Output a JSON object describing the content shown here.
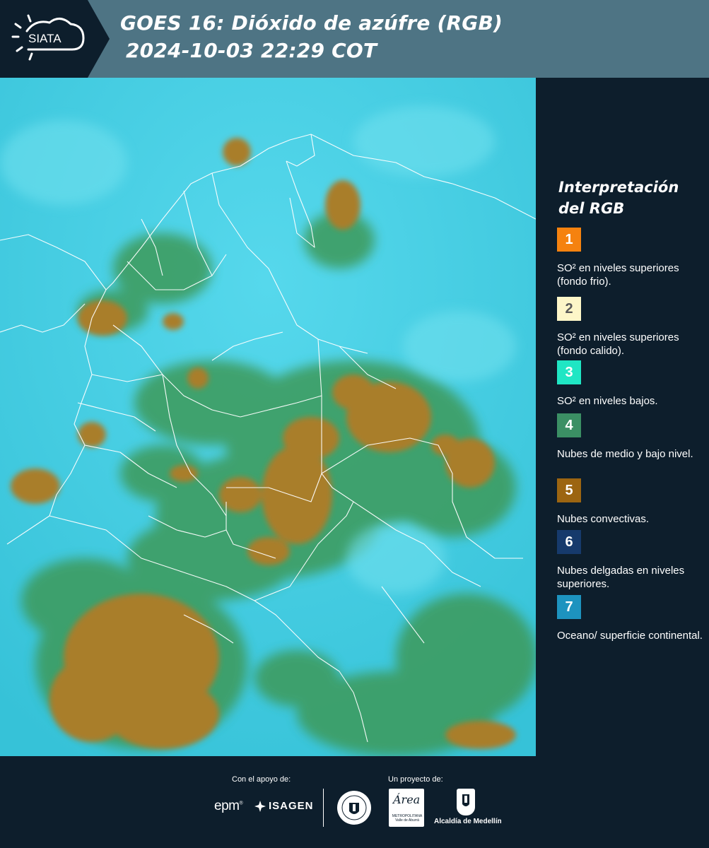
{
  "header": {
    "logo_text": "SIATA",
    "title_line1": "GOES 16: Dióxido de azúfre (RGB)",
    "title_line2": "2024-10-03 22:29 COT"
  },
  "legend": {
    "title": "Interpretación del RGB",
    "items": [
      {
        "number": "1",
        "color": "#f5820f",
        "number_color": "#ffffff",
        "description": "SO² en niveles superiores (fondo frio)."
      },
      {
        "number": "2",
        "color": "#fdf6c8",
        "number_color": "#5a5a5a",
        "description": "SO² en niveles superiores (fondo calido)."
      },
      {
        "number": "3",
        "color": "#1fe6c4",
        "number_color": "#ffffff",
        "description": "SO² en niveles bajos."
      },
      {
        "number": "4",
        "color": "#3b8f64",
        "number_color": "#ffffff",
        "description": "Nubes de medio y bajo nivel."
      },
      {
        "number": "5",
        "color": "#9c6511",
        "number_color": "#ffffff",
        "description": "Nubes convectivas."
      },
      {
        "number": "6",
        "color": "#163a6c",
        "number_color": "#ffffff",
        "description": "Nubes delgadas en niveles superiores."
      },
      {
        "number": "7",
        "color": "#1d93bf",
        "number_color": "#ffffff",
        "description": "Oceano/ superficie continental."
      }
    ]
  },
  "footer": {
    "support_label": "Con el apoyo de:",
    "project_label": "Un proyecto de:",
    "sponsors": [
      "epm",
      "ISAGEN"
    ],
    "epm_text": "epm",
    "isagen_text": "ISAGEN",
    "area_text": "Área",
    "area_subtext": "METROPOLITANA Valle de Aburrá",
    "alcaldia_text": "Alcaldía de Medellín"
  },
  "map": {
    "background_color": "#3fcde0",
    "convective_color": "#a97e2c",
    "midlevel_color": "#3c8f52",
    "border_color": "#ffffff"
  }
}
